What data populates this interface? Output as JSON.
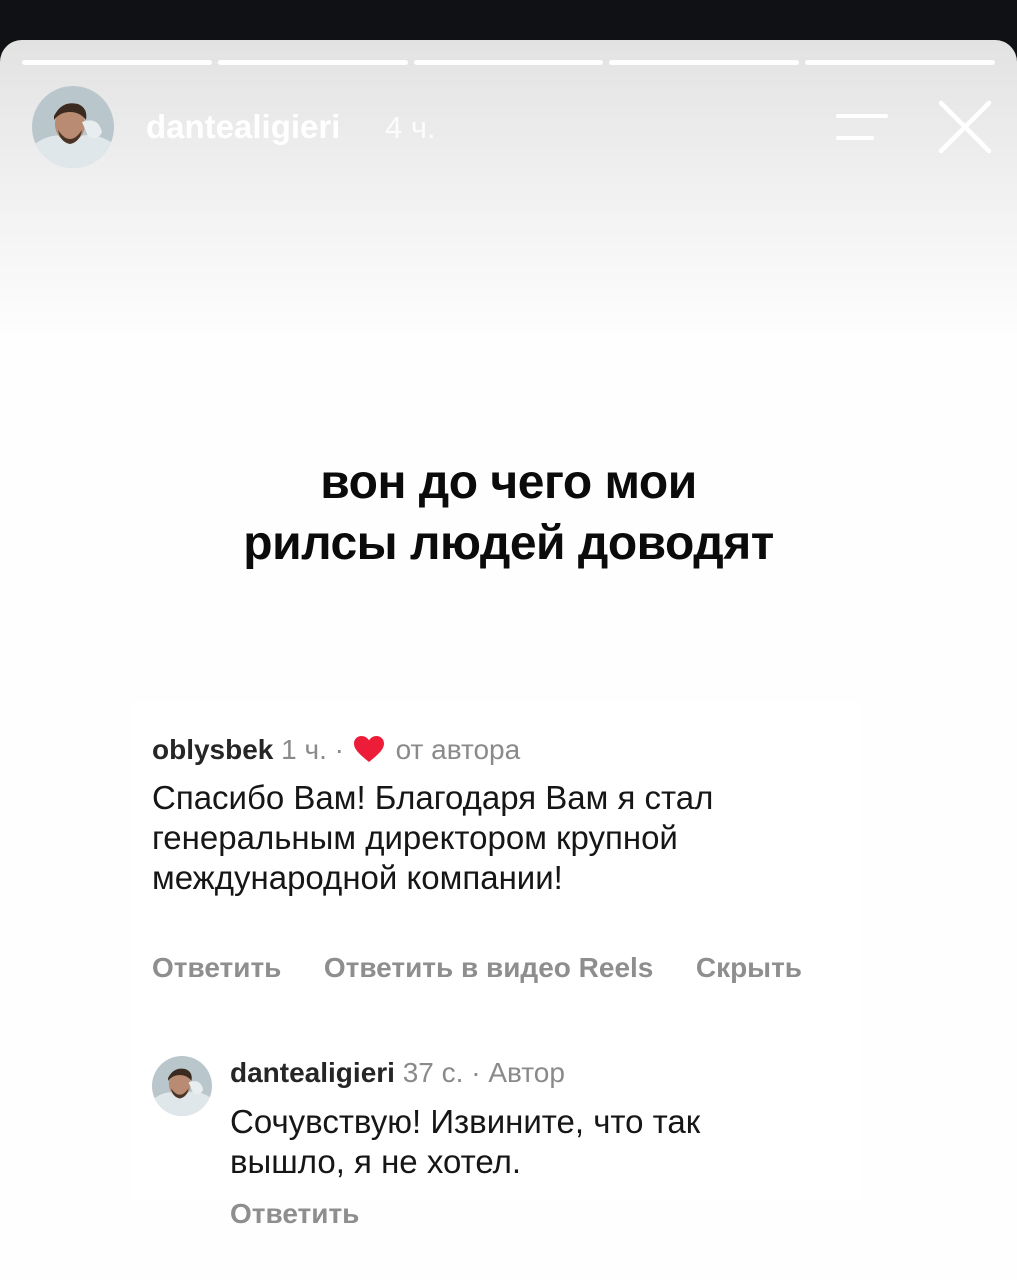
{
  "story": {
    "progress_segments": 5,
    "username": "dantealigieri",
    "time": "4 ч.",
    "headline": [
      "вон до чего мои",
      "рилсы людей доводят"
    ]
  },
  "comment": {
    "username": "oblysbek",
    "time": "1 ч.",
    "separator": "·",
    "liked_label": "от автора",
    "text": [
      "Спасибо Вам! Благодаря Вам я стал",
      "генеральным директором крупной",
      "международной компании!"
    ],
    "actions": {
      "reply": "Ответить",
      "reply_reels": "Ответить в видео Reels",
      "hide": "Скрыть"
    }
  },
  "reply": {
    "username": "dantealigieri",
    "time": "37 с.",
    "separator": "·",
    "role": "Автор",
    "text": [
      "Сочувствую! Извините, что так",
      "вышло, я не хотел."
    ],
    "reply_action": "Ответить"
  },
  "colors": {
    "heart": "#ed1d3a",
    "muted_text": "#8e8e8e",
    "top_bar": "#0f1114"
  },
  "icons": [
    "menu-icon",
    "close-icon",
    "heart-icon",
    "avatar"
  ]
}
